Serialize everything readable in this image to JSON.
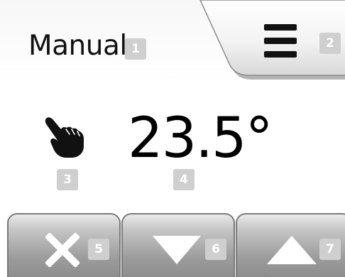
{
  "header": {
    "mode_label": "Manual",
    "mode_badge": "1",
    "menu_badge": "2"
  },
  "main": {
    "mode_icon": "hand-pointer-icon",
    "mode_icon_badge": "3",
    "temperature": "23.5°",
    "temperature_badge": "4"
  },
  "buttons": [
    {
      "icon": "close-x-icon",
      "badge": "5"
    },
    {
      "icon": "down-triangle-icon",
      "badge": "6"
    },
    {
      "icon": "up-triangle-icon",
      "badge": "7"
    }
  ],
  "colors": {
    "badge": "#cfcfcf",
    "button_top": "#eaeaea",
    "button_bottom": "#8a8a8a",
    "text": "#111111"
  }
}
